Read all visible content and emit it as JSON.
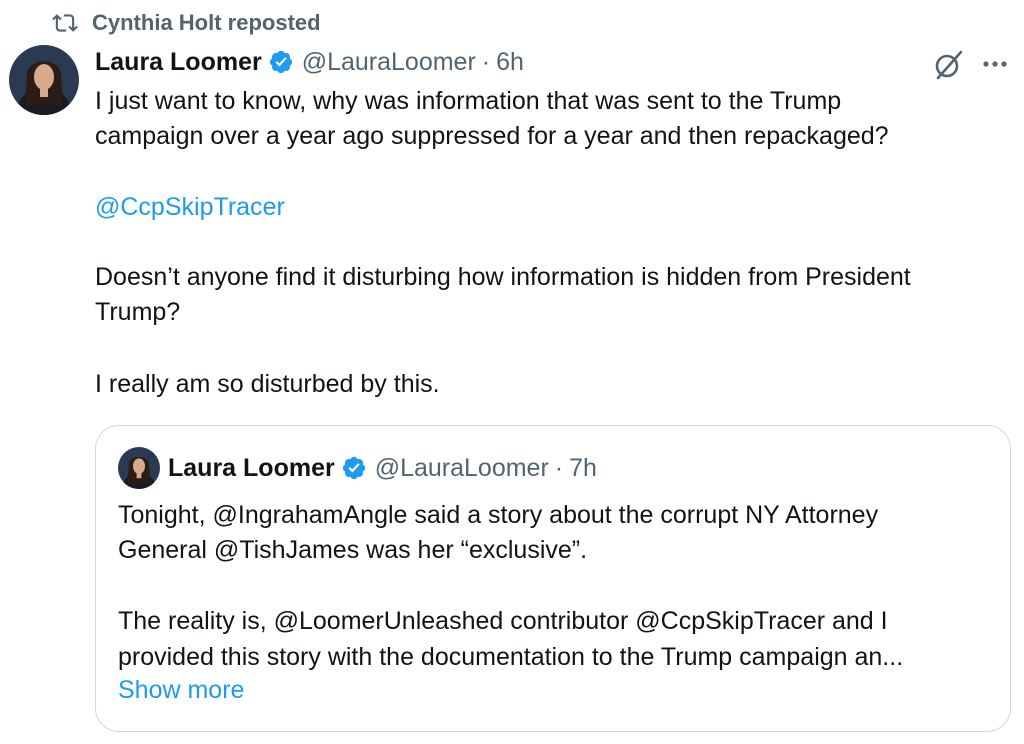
{
  "repost": {
    "label": "Cynthia Holt reposted"
  },
  "tweet": {
    "author_name": "Laura Loomer",
    "handle": "@LauraLoomer",
    "separator": "·",
    "time": "6h",
    "paragraph_1_line_1": "I just want to know, why was information that was sent to the Trump",
    "paragraph_1_line_2": "campaign over a year ago suppressed for a year and then repackaged?",
    "mention_line": "@CcpSkipTracer",
    "paragraph_2_line_1": "Doesn’t anyone find it disturbing how information is hidden from President",
    "paragraph_2_line_2": "Trump?",
    "paragraph_3": "I really am so disturbed by this."
  },
  "quoted_tweet": {
    "author_name": "Laura Loomer",
    "handle": "@LauraLoomer",
    "separator": "·",
    "time": "7h",
    "line_1_a": "Tonight, @IngrahamAngle said a story about the corrupt NY Attorney",
    "line_2": "General @TishJames was her “exclusive”.",
    "line_3": "The reality is, @LoomerUnleashed contributor @CcpSkipTracer and I",
    "line_4": "provided this story with the documentation to the Trump campaign an...",
    "show_more": "Show more"
  },
  "colors": {
    "text": "#0f1419",
    "secondary": "#536471",
    "accent": "#1d9bf0",
    "border": "#cfd9de"
  },
  "icons": [
    "repost-icon",
    "verified-badge-icon",
    "grok-icon",
    "more-options-icon"
  ]
}
